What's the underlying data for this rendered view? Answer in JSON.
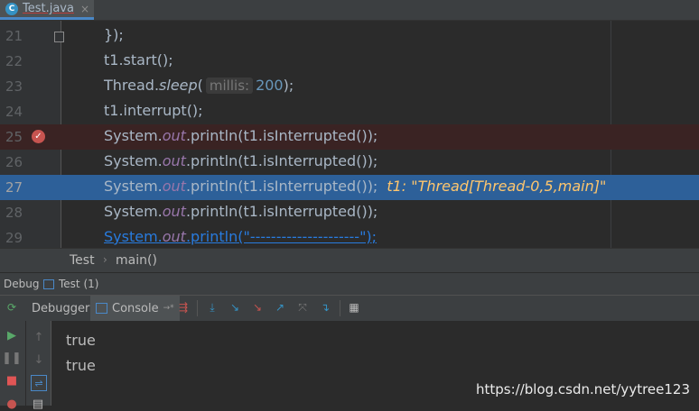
{
  "tab": {
    "label": "Test.java",
    "icon": "class-icon",
    "close": "×"
  },
  "editor": {
    "lines": [
      {
        "num": "21"
      },
      {
        "num": "22"
      },
      {
        "num": "23"
      },
      {
        "num": "24"
      },
      {
        "num": "25"
      },
      {
        "num": "26"
      },
      {
        "num": "27"
      },
      {
        "num": "28"
      },
      {
        "num": "29"
      }
    ],
    "code": {
      "l21": "});",
      "l22": "t1.start();",
      "l23_pre": "Thread.",
      "l23_method": "sleep",
      "l23_open": "(",
      "l23_hint": "millis:",
      "l23_num": "200",
      "l23_close": ");",
      "sys": "System.",
      "out": "out",
      "println": ".println(t1.isInterrupted());",
      "l24": "t1.interrupt();",
      "l27_inline": "t1: \"Thread[Thread-0,5,main]\"",
      "l29_sys": "System.",
      "l29_out": "out",
      "l29_rest": ".println(\"---------------------\");"
    }
  },
  "breadcrumbs": {
    "class": "Test",
    "sep": "›",
    "method": "main()"
  },
  "debug": {
    "title": "Debug",
    "session": "Test (1)"
  },
  "toolbar": {
    "debugger": "Debugger",
    "console": "Console",
    "console_suffix": "→*"
  },
  "console": {
    "lines": [
      "true",
      "true"
    ]
  },
  "watermark": "https://blog.csdn.net/yytree123",
  "colors": {
    "accent": "#2d6099",
    "breakpoint": "#c75450",
    "field": "#9876aa",
    "number": "#6897bb"
  }
}
